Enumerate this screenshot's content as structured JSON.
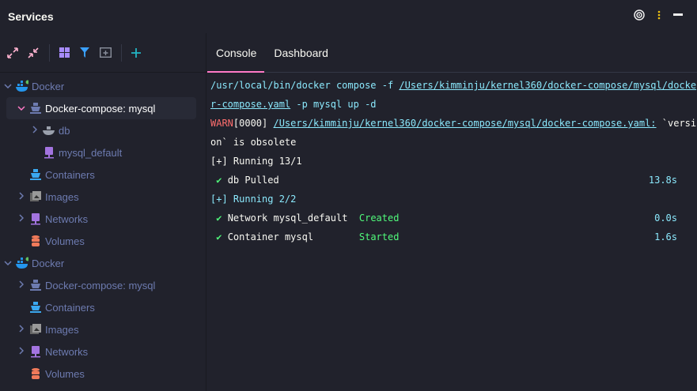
{
  "header": {
    "title": "Services"
  },
  "toolbar": {
    "icons": [
      "expand-all-icon",
      "collapse-all-icon",
      "group-icon",
      "filter-icon",
      "new-tab-icon",
      "add-icon"
    ]
  },
  "tree": [
    {
      "label": "Docker",
      "level": 0,
      "chev": "v",
      "icon": "docker"
    },
    {
      "label": "Docker-compose: mysql",
      "level": 1,
      "chev": "v",
      "icon": "compose",
      "selected": true
    },
    {
      "label": "db",
      "level": 2,
      "chev": ">",
      "icon": "whale"
    },
    {
      "label": "mysql_default",
      "level": 2,
      "chev": "",
      "icon": "network"
    },
    {
      "label": "Containers",
      "level": 1,
      "chev": "",
      "icon": "containers"
    },
    {
      "label": "Images",
      "level": 1,
      "chev": ">",
      "icon": "images"
    },
    {
      "label": "Networks",
      "level": 1,
      "chev": ">",
      "icon": "network"
    },
    {
      "label": "Volumes",
      "level": 1,
      "chev": "",
      "icon": "volumes"
    },
    {
      "label": "Docker",
      "level": 0,
      "chev": "v",
      "icon": "docker"
    },
    {
      "label": "Docker-compose: mysql",
      "level": 1,
      "chev": ">",
      "icon": "compose"
    },
    {
      "label": "Containers",
      "level": 1,
      "chev": "",
      "icon": "containers"
    },
    {
      "label": "Images",
      "level": 1,
      "chev": ">",
      "icon": "images"
    },
    {
      "label": "Networks",
      "level": 1,
      "chev": ">",
      "icon": "network"
    },
    {
      "label": "Volumes",
      "level": 1,
      "chev": "",
      "icon": "volumes"
    }
  ],
  "tabs": {
    "console": "Console",
    "dashboard": "Dashboard"
  },
  "console": {
    "cmd": "/usr/local/bin/docker compose -f ",
    "cmd_path1": "/Users/kimminju/kernel360/docker-compose/mysql/docke",
    "cmd_path2": "r-compose.yaml",
    "cmd_rest": " -p mysql up -d",
    "warn": "WARN",
    "warn_code": "[0000] ",
    "warn_path": "/Users/kimminju/kernel360/docker-compose/mysql/docker-compose.yaml:",
    "warn_msg1": " `versi",
    "warn_msg2": "on` is obsolete",
    "running1": "[+] Running 13/1",
    "check": "✔",
    "db_pulled": "db Pulled",
    "db_time": "13.8s",
    "running2": "[+] Running 2/2",
    "network": "Network mysql_default  ",
    "network_status": "Created",
    "network_time": "0.0s",
    "container": "Container mysql        ",
    "container_status": "Started",
    "container_time": "1.6s"
  }
}
